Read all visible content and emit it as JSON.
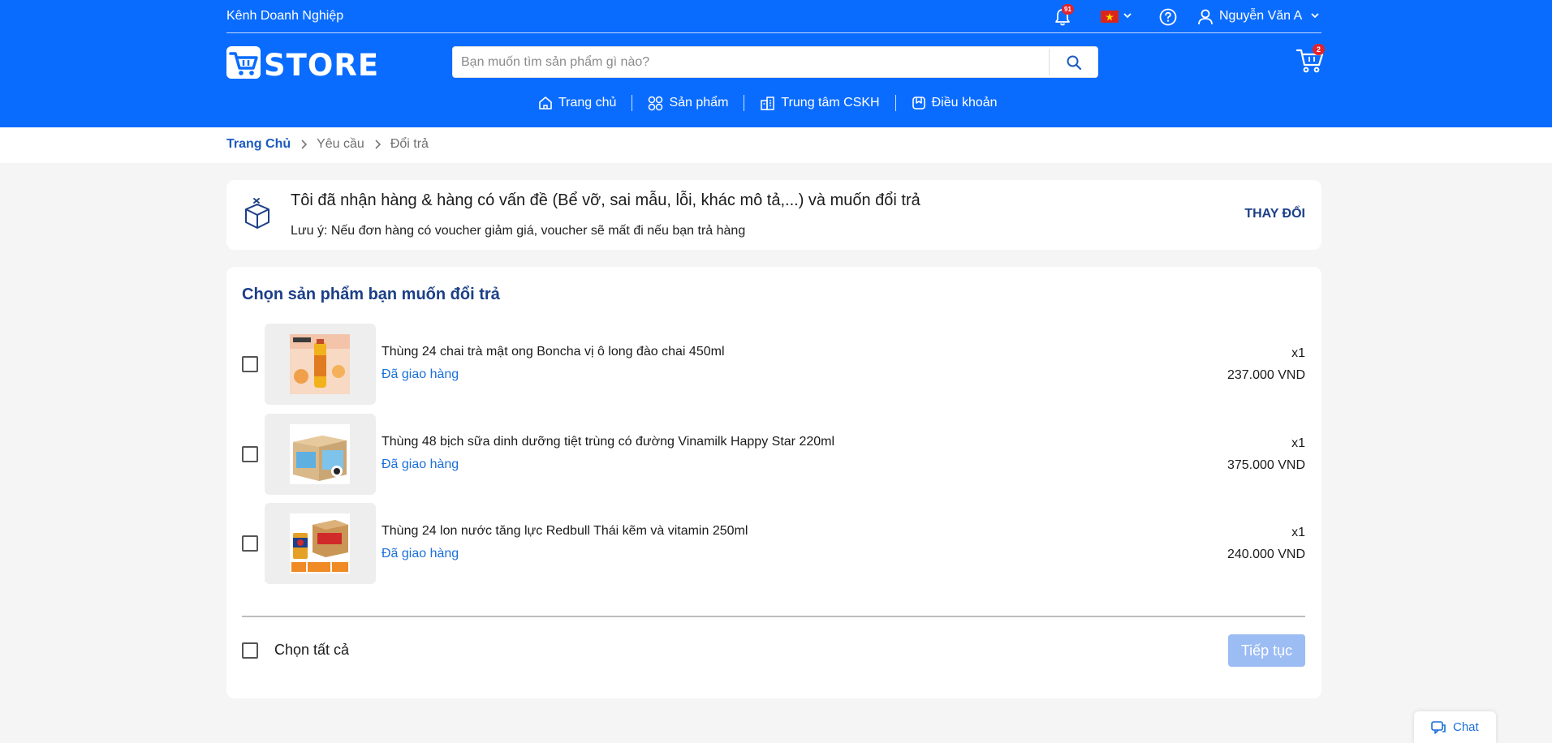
{
  "header": {
    "business_channel": "Kênh Doanh Nghiệp",
    "notification_count": "91",
    "user_name": "Nguyễn Văn A",
    "logo_text": "STORE",
    "search_placeholder": "Bạn muốn tìm sản phẩm gì nào?",
    "cart_count": "2",
    "brand_color": "#0a6cff",
    "nav": [
      {
        "label": "Trang chủ",
        "icon": "home-icon"
      },
      {
        "label": "Sản phẩm",
        "icon": "grid-icon"
      },
      {
        "label": "Trung tâm CSKH",
        "icon": "building-icon"
      },
      {
        "label": "Điều khoản",
        "icon": "terms-icon"
      }
    ]
  },
  "breadcrumb": {
    "home": "Trang Chủ",
    "request": "Yêu cầu",
    "current": "Đổi trả"
  },
  "reason": {
    "title": "Tôi đã nhận hàng & hàng có vấn đề (Bể vỡ, sai mẫu, lỗi, khác mô tả,...) và muốn đổi trả",
    "note": "Lưu ý: Nếu đơn hàng có voucher giảm giá, voucher sẽ mất đi nếu bạn trả hàng",
    "change_label": "THAY ĐỔI"
  },
  "products": {
    "title": "Chọn sản phẩm bạn muốn đổi trả",
    "items": [
      {
        "name": "Thùng 24 chai trà mật ong Boncha vị ô long đào chai 450ml",
        "status": "Đã giao hàng",
        "qty": "x1",
        "price": "237.000 VND"
      },
      {
        "name": "Thùng 48 bịch sữa dinh dưỡng tiệt trùng có đường Vinamilk Happy Star 220ml",
        "status": "Đã giao hàng",
        "qty": "x1",
        "price": "375.000 VND"
      },
      {
        "name": "Thùng 24 lon nước tăng lực Redbull Thái kẽm và vitamin 250ml",
        "status": "Đã giao hàng",
        "qty": "x1",
        "price": "240.000 VND"
      }
    ],
    "select_all": "Chọn tất cả",
    "continue_label": "Tiếp tục"
  },
  "chat": {
    "label": "Chat"
  }
}
